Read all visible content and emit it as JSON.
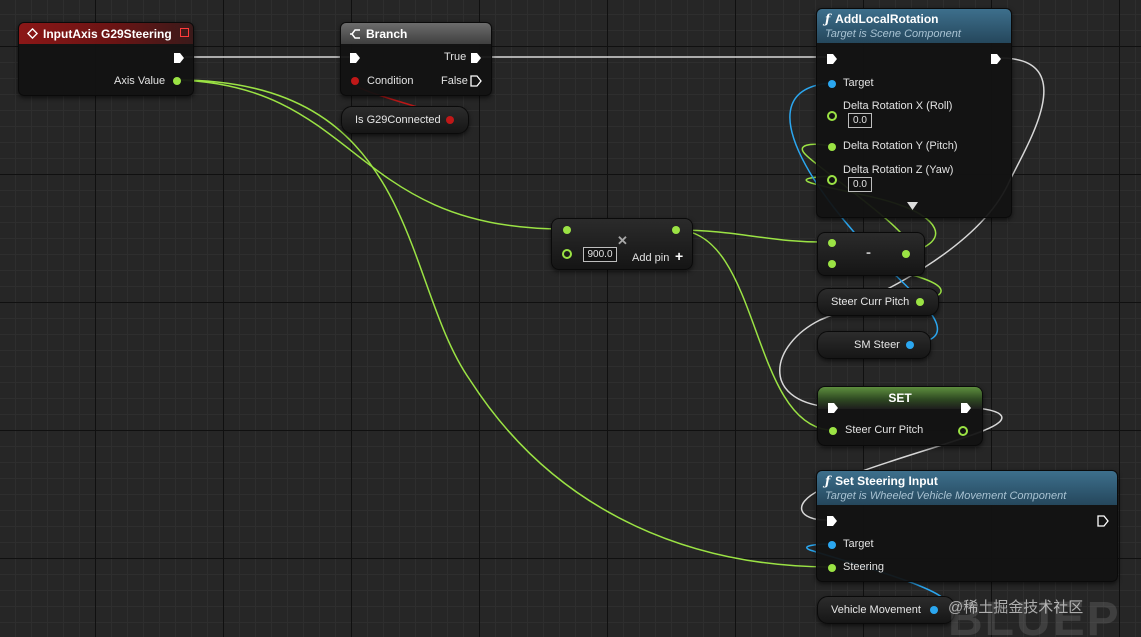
{
  "colors": {
    "exec": "#ffffff",
    "float": "#9be344",
    "object": "#2ba7f0",
    "bool": "#c01818",
    "header_red": "#8b1717",
    "header_blue": "#3d6f8c",
    "header_grey": "#5a5a5a"
  },
  "input_node": {
    "title": "InputAxis G29Steering",
    "axis_value": "Axis Value",
    "icon": "diamond-event-icon",
    "badge_icon": "delegate-square-icon"
  },
  "branch_node": {
    "title": "Branch",
    "true_label": "True",
    "condition_label": "Condition",
    "false_label": "False",
    "icon": "branch-icon"
  },
  "is_connected_node": {
    "label": "Is G29Connected"
  },
  "add_rotation_node": {
    "title": "AddLocalRotation",
    "subtitle": "Target is Scene Component",
    "target": "Target",
    "roll_label": "Delta Rotation X (Roll)",
    "roll_value": "0.0",
    "pitch_label": "Delta Rotation Y (Pitch)",
    "yaw_label": "Delta Rotation Z (Yaw)",
    "yaw_value": "0.0",
    "icon": "function-icon",
    "expand_icon": "expand-arrow-icon"
  },
  "divide_node": {
    "value": "900.0",
    "add_pin": "Add pin",
    "add_icon": "plus-icon",
    "close_icon": "x-icon"
  },
  "subtract_node": {
    "symbol": "-"
  },
  "steer_curr_pitch_get": {
    "label": "Steer Curr Pitch"
  },
  "sm_steer_get": {
    "label": "SM Steer"
  },
  "set_node": {
    "title": "SET",
    "var_label": "Steer Curr Pitch"
  },
  "set_steering_node": {
    "title": "Set Steering Input",
    "subtitle": "Target is Wheeled Vehicle Movement Component",
    "target": "Target",
    "steering": "Steering",
    "icon": "function-icon"
  },
  "vehicle_movement_get": {
    "label": "Vehicle Movement"
  },
  "watermark": {
    "text": "BLUEP",
    "site": "@稀土掘金技术社区"
  }
}
